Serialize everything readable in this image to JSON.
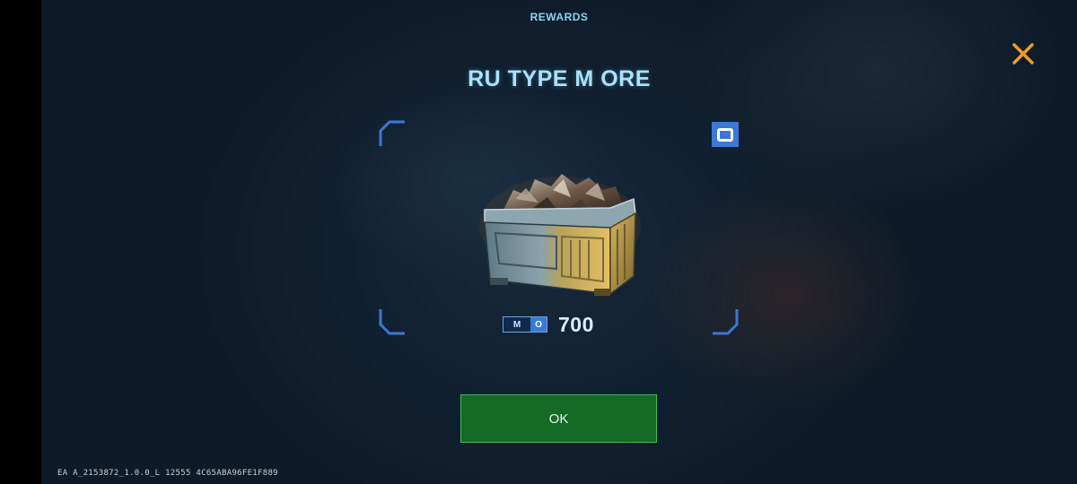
{
  "header": {
    "title": "REWARDS"
  },
  "close": {
    "icon": "close-x-icon",
    "color": "#f29a2e"
  },
  "reward": {
    "name": "RU TYPE M ORE",
    "rarity_badge": "O",
    "resource_tag": {
      "prefix": "M",
      "suffix": "O"
    },
    "amount": "700",
    "image": "ore-crate-image"
  },
  "actions": {
    "ok_label": "OK"
  },
  "footer": {
    "build_info": "EA A_2153872_1.0.0_L 12555 4C65ABA96FE1F889"
  },
  "colors": {
    "accent_blue": "#3c78d4",
    "button_green": "#156a26",
    "title_color": "#a9e2fb"
  }
}
